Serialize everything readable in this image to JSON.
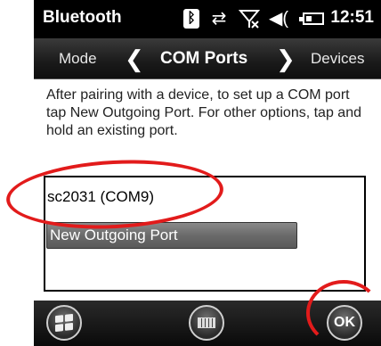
{
  "status_bar": {
    "title": "Bluetooth",
    "time": "12:51",
    "icons": [
      "bluetooth-icon",
      "sync-icon",
      "signal-off-icon",
      "volume-icon",
      "battery-icon"
    ]
  },
  "nav": {
    "previous": "Mode",
    "current": "COM Ports",
    "next": "Devices",
    "left_arrow": "❮",
    "right_arrow": "❯"
  },
  "instructions": "After pairing with a device, to set up a COM port tap New Outgoing Port. For other options, tap and hold an existing port.",
  "ports": {
    "items": [
      {
        "label": "sc2031 (COM9)"
      }
    ],
    "new_port_label": "New Outgoing Port"
  },
  "bottom_bar": {
    "ok_label": "OK",
    "icons": [
      "windows-start-icon",
      "keyboard-icon"
    ]
  },
  "colors": {
    "annotation": "#e21b1b",
    "header_bg": "#000000",
    "button_gray": "#6a6a6a"
  }
}
